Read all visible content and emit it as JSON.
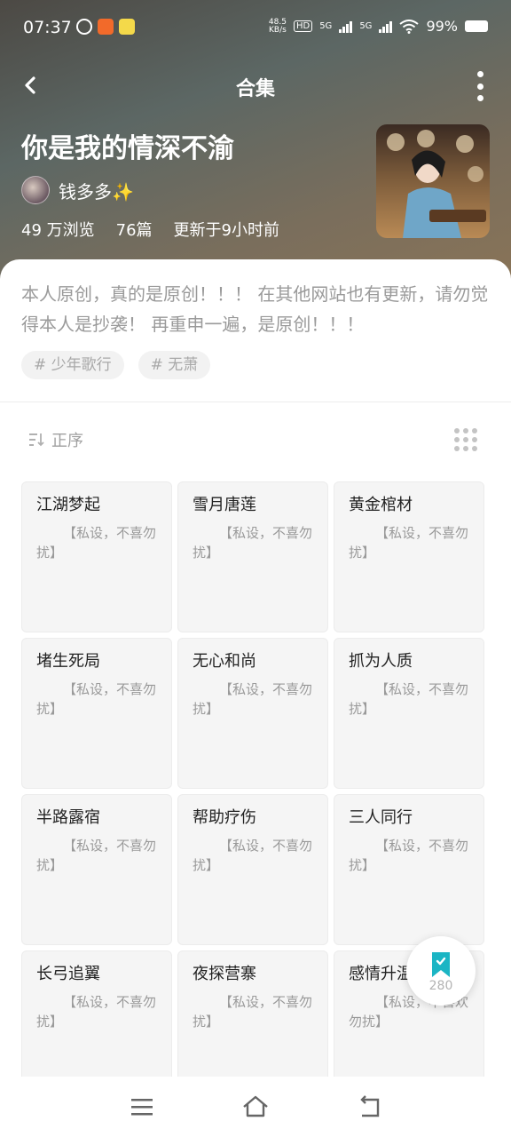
{
  "status": {
    "time": "07:37",
    "netspeed_value": "48.5",
    "netspeed_unit": "KB/s",
    "hd_label": "HD",
    "net1": "5G",
    "net2": "5G",
    "battery": "99%"
  },
  "header": {
    "title": "合集"
  },
  "collection": {
    "name": "你是我的情深不渝",
    "author": "钱多多✨",
    "views": "49 万浏览",
    "count": "76篇",
    "updated": "更新于9小时前",
    "description": "本人原创，真的是原创！！！ 在其他网站也有更新，请勿觉得本人是抄袭！ 再重申一遍，是原创！！！",
    "tags": [
      "# 少年歌行",
      "# 无萧"
    ]
  },
  "sort": {
    "label": "正序"
  },
  "chapters": [
    {
      "title": "江湖梦起",
      "snippet": "【私设，不喜勿扰】"
    },
    {
      "title": "雪月唐莲",
      "snippet": "【私设，不喜勿扰】"
    },
    {
      "title": "黄金棺材",
      "snippet": "【私设，不喜勿扰】"
    },
    {
      "title": "堵生死局",
      "snippet": "【私设，不喜勿扰】"
    },
    {
      "title": "无心和尚",
      "snippet": "【私设，不喜勿扰】"
    },
    {
      "title": "抓为人质",
      "snippet": "【私设，不喜勿扰】"
    },
    {
      "title": "半路露宿",
      "snippet": "【私设，不喜勿扰】"
    },
    {
      "title": "帮助疗伤",
      "snippet": "【私设，不喜勿扰】"
    },
    {
      "title": "三人同行",
      "snippet": "【私设，不喜勿扰】"
    },
    {
      "title": "长弓追翼",
      "snippet": "【私设，不喜勿扰】"
    },
    {
      "title": "夜探营寨",
      "snippet": "【私设，不喜勿扰】"
    },
    {
      "title": "感情升温",
      "snippet": "【私设，不喜欢勿扰】"
    }
  ],
  "fab": {
    "count": "280",
    "color": "#1bb5c4"
  }
}
